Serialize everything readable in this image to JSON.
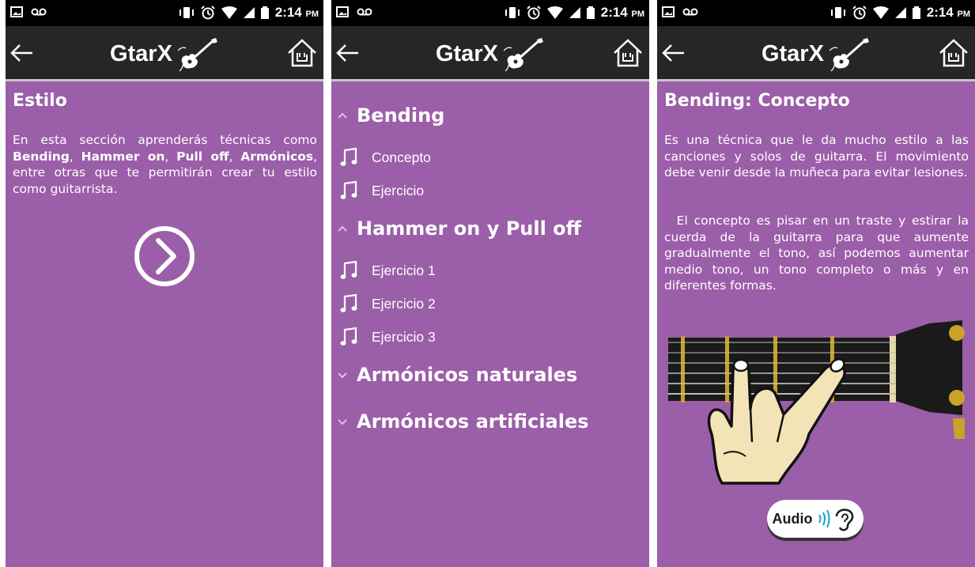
{
  "status_bar": {
    "time": "2:14",
    "ampm": "PM"
  },
  "app": {
    "title": "GtarX"
  },
  "screen1": {
    "heading": "Estilo",
    "intro_prefix": "En esta sección aprenderás técnicas como ",
    "techniques": [
      "Bending",
      "Hammer on",
      "Pull off",
      "Armónicos"
    ],
    "separator": ", ",
    "intro_suffix": ", entre otras que te permitirán crear tu estilo como guitarrista."
  },
  "screen2": {
    "groups": [
      {
        "label": "Bending",
        "expanded": true,
        "items": [
          "Concepto",
          "Ejercicio"
        ]
      },
      {
        "label": "Hammer on y Pull off",
        "expanded": true,
        "items": [
          "Ejercicio 1",
          "Ejercicio 2",
          "Ejercicio 3"
        ]
      },
      {
        "label": "Armónicos naturales",
        "expanded": false,
        "items": []
      },
      {
        "label": "Armónicos artificiales",
        "expanded": false,
        "items": []
      }
    ]
  },
  "screen3": {
    "title": "Bending: Concepto",
    "paragraph1": "Es una técnica que le da mucho estilo a las canciones y solos de guitarra. El movimiento debe venir desde la muñeca para evitar lesiones.",
    "paragraph2": "  El concepto es pisar en un traste y estirar la cuerda de la guitarra para que aumente gradualmente el tono, así podemos aumentar medio tono, un tono completo o más y en diferentes formas.",
    "audio_label": "Audio"
  },
  "colors": {
    "background": "#9b5ea8",
    "appbar": "#262626",
    "statusbar": "#000000"
  },
  "icons": [
    "back-arrow-icon",
    "home-rock-icon",
    "guitar-logo-icon",
    "chevron-right-circle-icon",
    "chevron-up-icon",
    "chevron-down-icon",
    "music-note-icon",
    "ear-sound-icon"
  ]
}
